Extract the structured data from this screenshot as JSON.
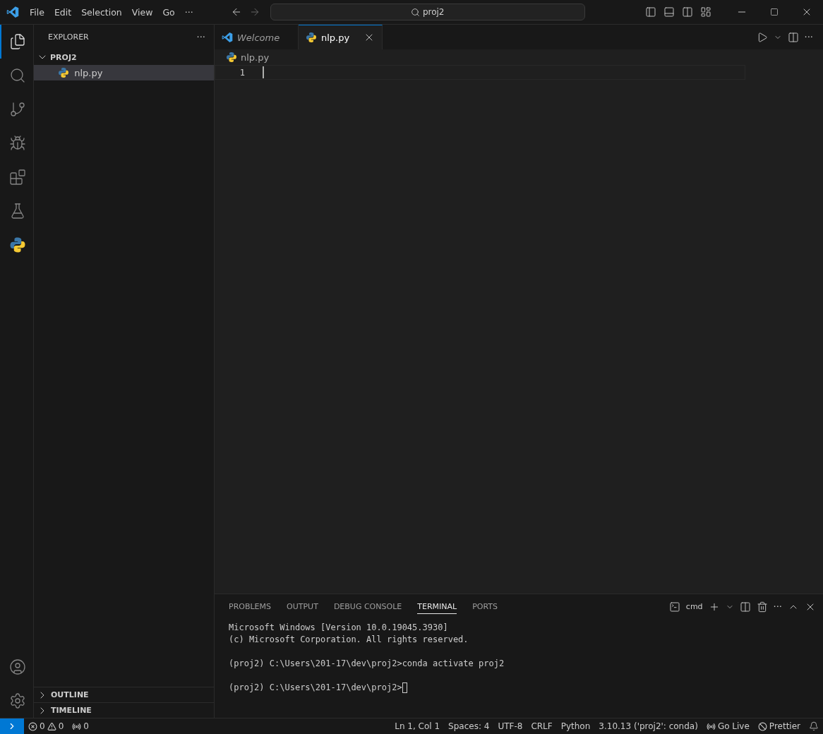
{
  "menu": [
    "File",
    "Edit",
    "Selection",
    "View",
    "Go",
    "···"
  ],
  "search": {
    "value": "proj2"
  },
  "activity_bar": [
    {
      "kind": "files",
      "selected": true
    },
    {
      "kind": "search",
      "selected": false
    },
    {
      "kind": "git",
      "selected": false
    },
    {
      "kind": "debug",
      "selected": false
    },
    {
      "kind": "extensions",
      "selected": false
    },
    {
      "kind": "testing",
      "selected": false
    },
    {
      "kind": "python",
      "selected": false
    }
  ],
  "sidebar": {
    "title": "EXPLORER",
    "more": "···",
    "folder": {
      "name": "PROJ2",
      "expanded": true,
      "children": [
        {
          "name": "nlp.py",
          "selected": true
        }
      ]
    },
    "sections": [
      {
        "name": "OUTLINE",
        "expanded": false
      },
      {
        "name": "TIMELINE",
        "expanded": false
      }
    ]
  },
  "tabs": [
    {
      "label": "Welcome",
      "kind": "welcome",
      "preview": true,
      "selected": false
    },
    {
      "label": "nlp.py",
      "kind": "python",
      "preview": false,
      "selected": true
    }
  ],
  "breadcrumb": "nlp.py",
  "editor": {
    "lines": [
      {
        "number": "1"
      }
    ]
  },
  "panel": {
    "tabs": [
      {
        "label": "PROBLEMS",
        "selected": false
      },
      {
        "label": "OUTPUT",
        "selected": false
      },
      {
        "label": "DEBUG CONSOLE",
        "selected": false
      },
      {
        "label": "TERMINAL",
        "selected": true
      },
      {
        "label": "PORTS",
        "selected": false
      }
    ],
    "shell": "cmd",
    "more": "···",
    "terminal": [
      [
        "Microsoft Windows [Version 10.0.19045.3930]",
        "(c) Microsoft Corporation. All rights reserved."
      ],
      [
        "(proj2) C:\\Users\\201-17\\dev\\proj2>conda activate proj2"
      ],
      [
        "(proj2) C:\\Users\\201-17\\dev\\proj2>"
      ]
    ]
  },
  "status_bar": {
    "errors": "0",
    "warnings": "0",
    "ports": "0",
    "right": [
      "Ln 1, Col 1",
      "Spaces: 4",
      "UTF-8",
      "CRLF",
      "Python",
      "3.10.13 ('proj2': conda)"
    ],
    "go_live": "Go Live",
    "prettier": "Prettier"
  }
}
